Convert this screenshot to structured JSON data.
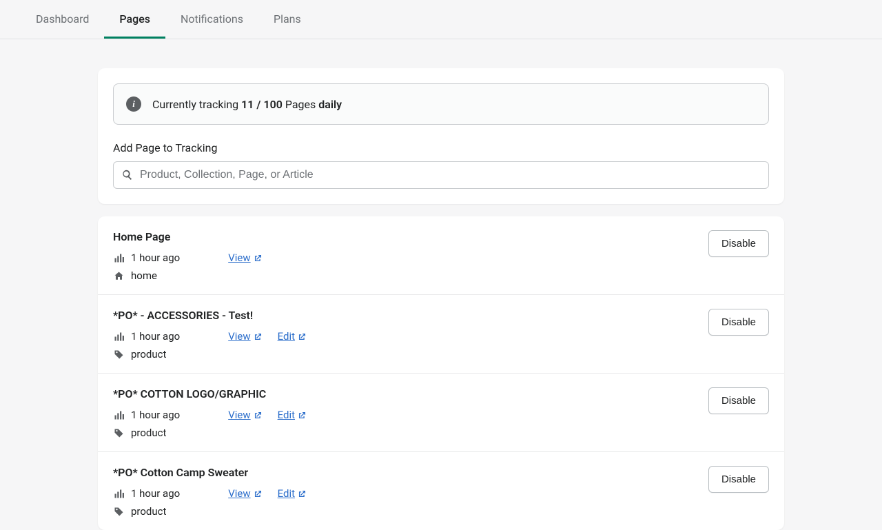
{
  "tabs": [
    "Dashboard",
    "Pages",
    "Notifications",
    "Plans"
  ],
  "active_tab": 1,
  "banner": {
    "prefix": "Currently tracking ",
    "count": "11 / 100",
    "mid": " Pages ",
    "freq": "daily"
  },
  "search": {
    "label": "Add Page to Tracking",
    "placeholder": "Product, Collection, Page, or Article"
  },
  "link_labels": {
    "view": "View",
    "edit": "Edit"
  },
  "disable_label": "Disable",
  "rows": [
    {
      "title": "Home Page",
      "time": "1 hour ago",
      "type_icon": "home",
      "type": "home",
      "has_edit": false
    },
    {
      "title": "*PO* - ACCESSORIES - Test!",
      "time": "1 hour ago",
      "type_icon": "tag",
      "type": "product",
      "has_edit": true
    },
    {
      "title": "*PO* COTTON LOGO/GRAPHIC",
      "time": "1 hour ago",
      "type_icon": "tag",
      "type": "product",
      "has_edit": true
    },
    {
      "title": "*PO* Cotton Camp Sweater",
      "time": "1 hour ago",
      "type_icon": "tag",
      "type": "product",
      "has_edit": true
    }
  ]
}
